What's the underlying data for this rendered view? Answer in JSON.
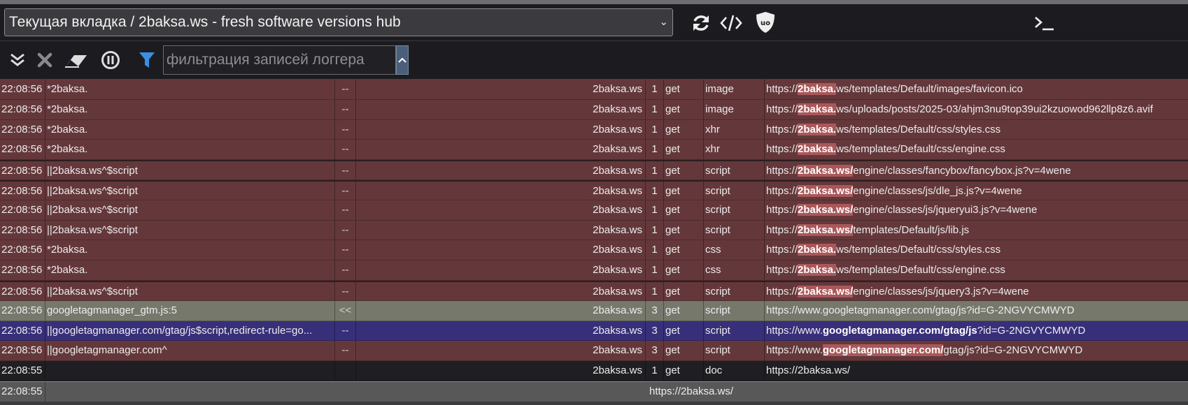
{
  "toolbar": {
    "tab_select": "Текущая вкладка / 2baksa.ws - fresh software versions hub",
    "icons": [
      "reload-icon",
      "code-icon",
      "ublock-logo-icon",
      "terminal-icon"
    ]
  },
  "filterbar": {
    "placeholder": "фильтрация записей логгера",
    "icons": [
      "expand-all-icon",
      "clear-icon",
      "eraser-icon",
      "pause-icon",
      "filter-icon"
    ],
    "accent_color": "#3c8fe0"
  },
  "colors": {
    "blocked": "#64383b",
    "redirect": "#77786c",
    "allowed": "#372f79",
    "highlight": "#a9585a"
  },
  "rows": [
    {
      "time": "22:08:56",
      "filter": "*2baksa.",
      "flag": "--",
      "context": "2baksa.ws",
      "party": "1",
      "method": "get",
      "type": "image",
      "url_pre": "https://",
      "url_hl": "2baksa.",
      "url_post": "ws/templates/Default/images/favicon.ico"
    },
    {
      "time": "22:08:56",
      "filter": "*2baksa.",
      "flag": "--",
      "context": "2baksa.ws",
      "party": "1",
      "method": "get",
      "type": "image",
      "url_pre": "https://",
      "url_hl": "2baksa.",
      "url_post": "ws/uploads/posts/2025-03/ahjm3nu9top39ui2kzuowod962llp8z6.avif"
    },
    {
      "time": "22:08:56",
      "filter": "*2baksa.",
      "flag": "--",
      "context": "2baksa.ws",
      "party": "1",
      "method": "get",
      "type": "xhr",
      "url_pre": "https://",
      "url_hl": "2baksa.",
      "url_post": "ws/templates/Default/css/styles.css"
    },
    {
      "time": "22:08:56",
      "filter": "*2baksa.",
      "flag": "--",
      "context": "2baksa.ws",
      "party": "1",
      "method": "get",
      "type": "xhr",
      "url_pre": "https://",
      "url_hl": "2baksa.",
      "url_post": "ws/templates/Default/css/engine.css"
    },
    {
      "time": "22:08:56",
      "filter": "||2baksa.ws^$script",
      "flag": "--",
      "context": "2baksa.ws",
      "party": "1",
      "method": "get",
      "type": "script",
      "url_pre": "https://",
      "url_hl": "2baksa.ws/",
      "url_post": "engine/classes/fancybox/fancybox.js?v=4wene"
    },
    {
      "time": "22:08:56",
      "filter": "||2baksa.ws^$script",
      "flag": "--",
      "context": "2baksa.ws",
      "party": "1",
      "method": "get",
      "type": "script",
      "url_pre": "https://",
      "url_hl": "2baksa.ws/",
      "url_post": "engine/classes/js/dle_js.js?v=4wene"
    },
    {
      "time": "22:08:56",
      "filter": "||2baksa.ws^$script",
      "flag": "--",
      "context": "2baksa.ws",
      "party": "1",
      "method": "get",
      "type": "script",
      "url_pre": "https://",
      "url_hl": "2baksa.ws/",
      "url_post": "engine/classes/js/jqueryui3.js?v=4wene"
    },
    {
      "time": "22:08:56",
      "filter": "||2baksa.ws^$script",
      "flag": "--",
      "context": "2baksa.ws",
      "party": "1",
      "method": "get",
      "type": "script",
      "url_pre": "https://",
      "url_hl": "2baksa.ws/",
      "url_post": "templates/Default/js/lib.js"
    },
    {
      "time": "22:08:56",
      "filter": "*2baksa.",
      "flag": "--",
      "context": "2baksa.ws",
      "party": "1",
      "method": "get",
      "type": "css",
      "url_pre": "https://",
      "url_hl": "2baksa.",
      "url_post": "ws/templates/Default/css/styles.css"
    },
    {
      "time": "22:08:56",
      "filter": "*2baksa.",
      "flag": "--",
      "context": "2baksa.ws",
      "party": "1",
      "method": "get",
      "type": "css",
      "url_pre": "https://",
      "url_hl": "2baksa.",
      "url_post": "ws/templates/Default/css/engine.css"
    },
    {
      "time": "22:08:56",
      "filter": "||2baksa.ws^$script",
      "flag": "--",
      "context": "2baksa.ws",
      "party": "1",
      "method": "get",
      "type": "script",
      "url_pre": "https://",
      "url_hl": "2baksa.ws/",
      "url_post": "engine/classes/js/jquery3.js?v=4wene"
    },
    {
      "time": "22:08:56",
      "filter": "googletagmanager_gtm.js:5",
      "flag": "<<",
      "context": "2baksa.ws",
      "party": "3",
      "method": "get",
      "type": "script",
      "url_pre": "https://www.googletagmanager.com/gtag/js?id=G-2NGVYCMWYD",
      "url_hl": "",
      "url_post": ""
    },
    {
      "time": "22:08:56",
      "filter": "||googletagmanager.com/gtag/js$script,redirect-rule=go...",
      "flag": "--",
      "context": "2baksa.ws",
      "party": "3",
      "method": "get",
      "type": "script",
      "url_pre": "https://www.",
      "url_hl": "googletagmanager.com/gtag/js",
      "url_post": "?id=G-2NGVYCMWYD"
    },
    {
      "time": "22:08:56",
      "filter": "||googletagmanager.com^",
      "flag": "--",
      "context": "2baksa.ws",
      "party": "3",
      "method": "get",
      "type": "script",
      "url_pre": "https://www.",
      "url_hl": "googletagmanager.com/",
      "url_post": "gtag/js?id=G-2NGVYCMWYD"
    },
    {
      "time": "22:08:55",
      "filter": "",
      "flag": "",
      "context": "2baksa.ws",
      "party": "1",
      "method": "get",
      "type": "doc",
      "url_pre": "https://2baksa.ws/",
      "url_hl": "",
      "url_post": ""
    }
  ],
  "nav_row": {
    "time": "22:08:55",
    "url": "https://2baksa.ws/"
  }
}
